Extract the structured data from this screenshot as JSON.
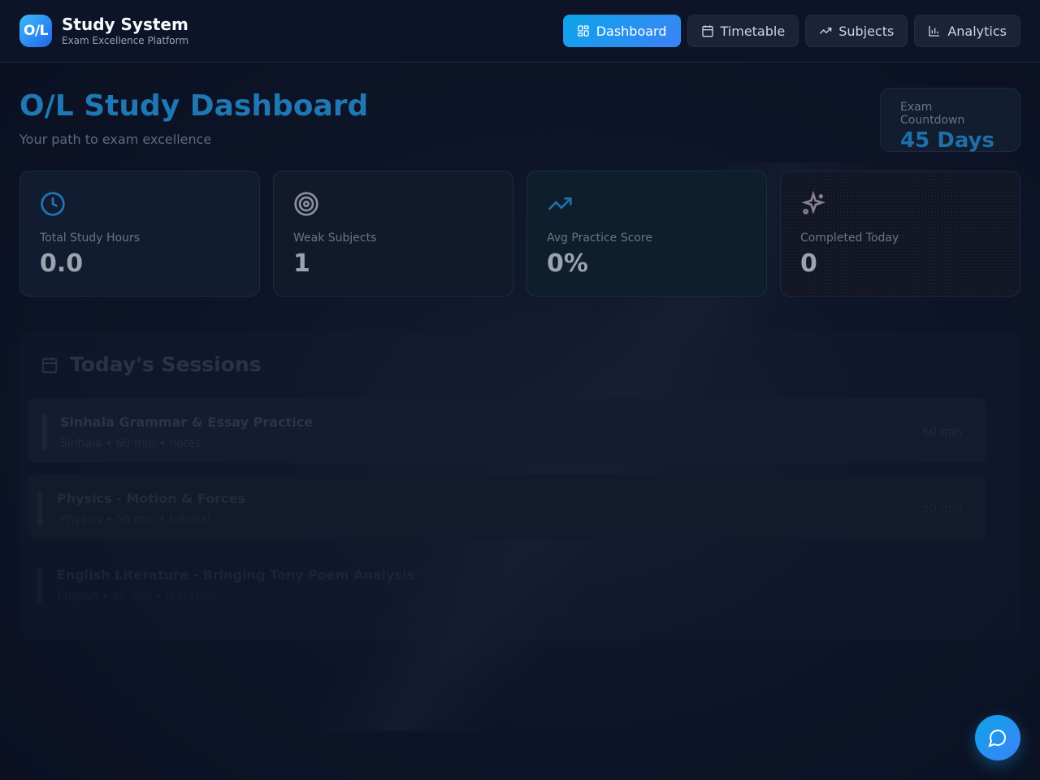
{
  "brand": {
    "logo": "O/L",
    "title": "Study System",
    "subtitle": "Exam Excellence Platform"
  },
  "nav": [
    {
      "label": "Dashboard",
      "icon": "grid-icon",
      "active": true
    },
    {
      "label": "Timetable",
      "icon": "calendar-icon",
      "active": false
    },
    {
      "label": "Subjects",
      "icon": "trending-up-icon",
      "active": false
    },
    {
      "label": "Analytics",
      "icon": "bar-chart-icon",
      "active": false
    }
  ],
  "page": {
    "title": "O/L Study Dashboard",
    "subtitle": "Your path to exam excellence"
  },
  "countdown": {
    "label": "Exam Countdown",
    "value": "45 Days"
  },
  "stats": [
    {
      "label": "Total Study Hours",
      "value": "0.0",
      "icon": "clock-icon",
      "color": "#1f78b4"
    },
    {
      "label": "Weak Subjects",
      "value": "1",
      "icon": "target-icon",
      "color": "#8a8f9c"
    },
    {
      "label": "Avg Practice Score",
      "value": "0%",
      "icon": "trending-up-icon",
      "color": "#1f6fa8"
    },
    {
      "label": "Completed Today",
      "value": "0",
      "icon": "sparkles-icon",
      "color": "#8a8190"
    }
  ],
  "sessions": {
    "title": "Today's Sessions",
    "items": [
      {
        "title": "Sinhala Grammar & Essay Practice",
        "meta": "Sinhala • 60 min • notes",
        "duration": "60 min"
      },
      {
        "title": "Physics - Motion & Forces",
        "meta": "Physics • 50 min • tutorial",
        "duration": "50 min"
      },
      {
        "title": "English Literature - Bringing Tony Poem Analysis",
        "meta": "English • 45 min • literature",
        "duration": ""
      }
    ]
  },
  "fab": {
    "icon": "chat-icon"
  }
}
